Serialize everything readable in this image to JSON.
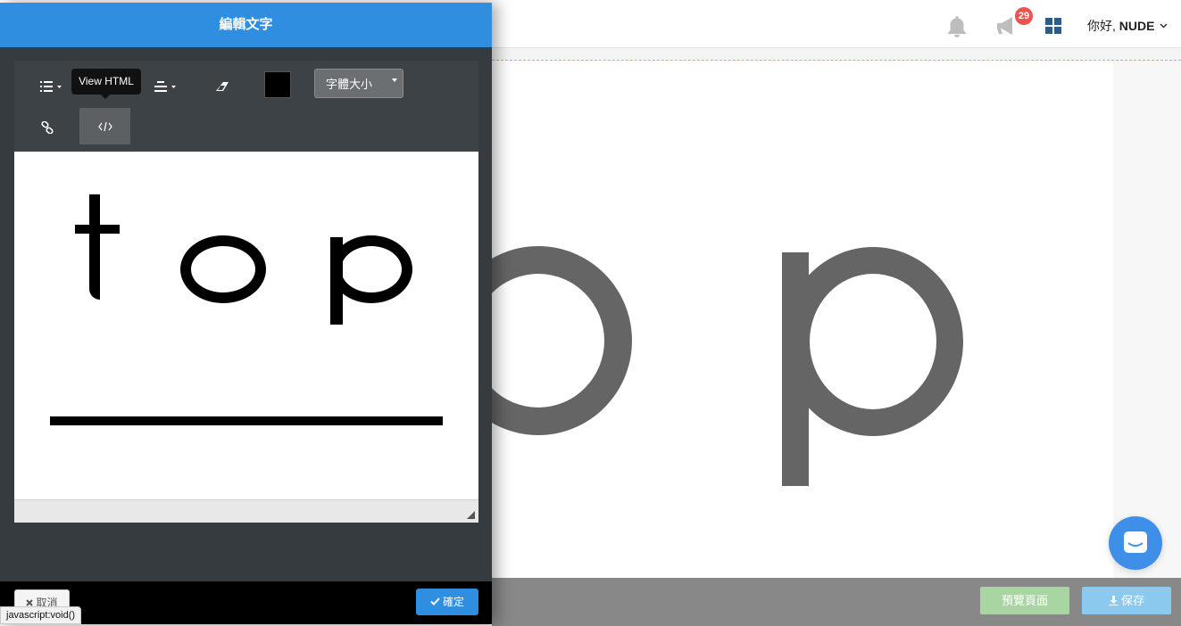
{
  "modal": {
    "title": "編輯文字",
    "toolbar": {
      "font_size_label": "字體大小",
      "tooltip": "View HTML",
      "text_color": "#000000"
    },
    "content": {
      "text": "t o p"
    },
    "footer": {
      "cancel_label": "取消",
      "ok_label": "確定"
    }
  },
  "header": {
    "notification_count": "29",
    "greeting_prefix": "你好,",
    "user_name": "NUDE"
  },
  "canvas": {
    "text": "o p"
  },
  "footer": {
    "preview_label": "預覽頁面",
    "save_label": "保存"
  },
  "status_url": "javascript:void()",
  "colors": {
    "accent": "#2f8ee0",
    "preview_button": "#a8d5a2",
    "save_button": "#8cc9ef",
    "badge": "#ef5350",
    "chat_bubble": "#3d8fe8"
  }
}
